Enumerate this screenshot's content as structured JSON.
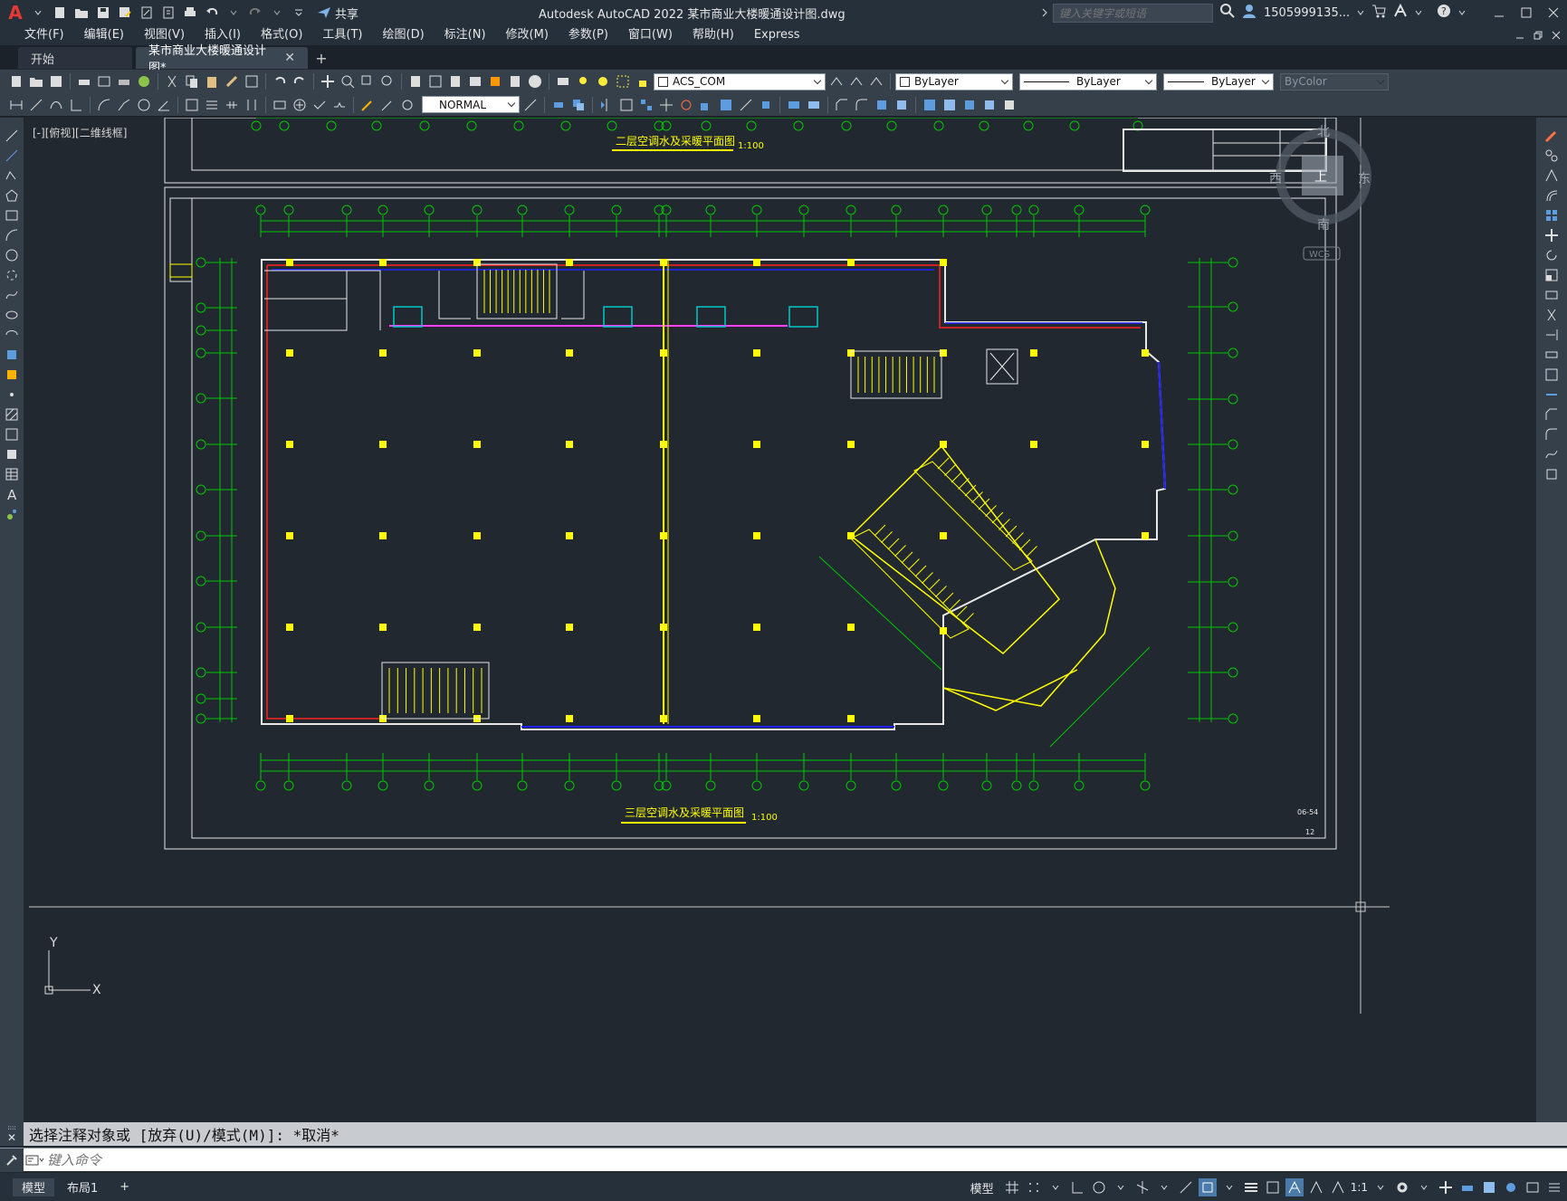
{
  "app": {
    "title": "Autodesk AutoCAD 2022    某市商业大楼暖通设计图.dwg",
    "share_label": "共享",
    "search_placeholder": "键入关键字或短语",
    "user": "1505999135...",
    "logo": "A"
  },
  "menu": {
    "items": [
      "文件(F)",
      "编辑(E)",
      "视图(V)",
      "插入(I)",
      "格式(O)",
      "工具(T)",
      "绘图(D)",
      "标注(N)",
      "修改(M)",
      "参数(P)",
      "窗口(W)",
      "帮助(H)",
      "Express"
    ]
  },
  "tabs": {
    "start": "开始",
    "active": "某市商业大楼暖通设计图*",
    "add": "+"
  },
  "toolbar": {
    "layer": "ACS_COM",
    "color": "ByLayer",
    "linetype": "ByLayer",
    "lineweight": "ByLayer",
    "plotstyle": "ByColor",
    "textstyle": "NORMAL"
  },
  "viewport": {
    "label": "[-][俯视][二维线框]"
  },
  "viewcube": {
    "north": "北",
    "south": "南",
    "east": "东",
    "west": "西",
    "top": "上",
    "wcs": "WCS"
  },
  "drawing": {
    "title_upper": "二层空调水及采暖平面图",
    "scale_upper": "1:100",
    "title_lower": "三层空调水及采暖平面图",
    "scale_lower": "1:100",
    "sheet_no": "12",
    "sheet_code": "06-54",
    "ucs_x": "X",
    "ucs_y": "Y"
  },
  "command": {
    "history": "选择注释对象或 [放弃(U)/模式(M)]: *取消*",
    "placeholder": "键入命令"
  },
  "status": {
    "layouts": [
      "模型",
      "布局1"
    ],
    "add": "+",
    "model": "模型",
    "scale": "1:1"
  },
  "colors": {
    "background": "#212830",
    "grid_green": "#00c800",
    "wall_white": "#e8e8e8",
    "column_yellow": "#ffff00",
    "pipe_red": "#ff2020",
    "pipe_blue": "#2020ff",
    "pipe_magenta": "#ff40ff",
    "unit_cyan": "#00c8c8"
  }
}
